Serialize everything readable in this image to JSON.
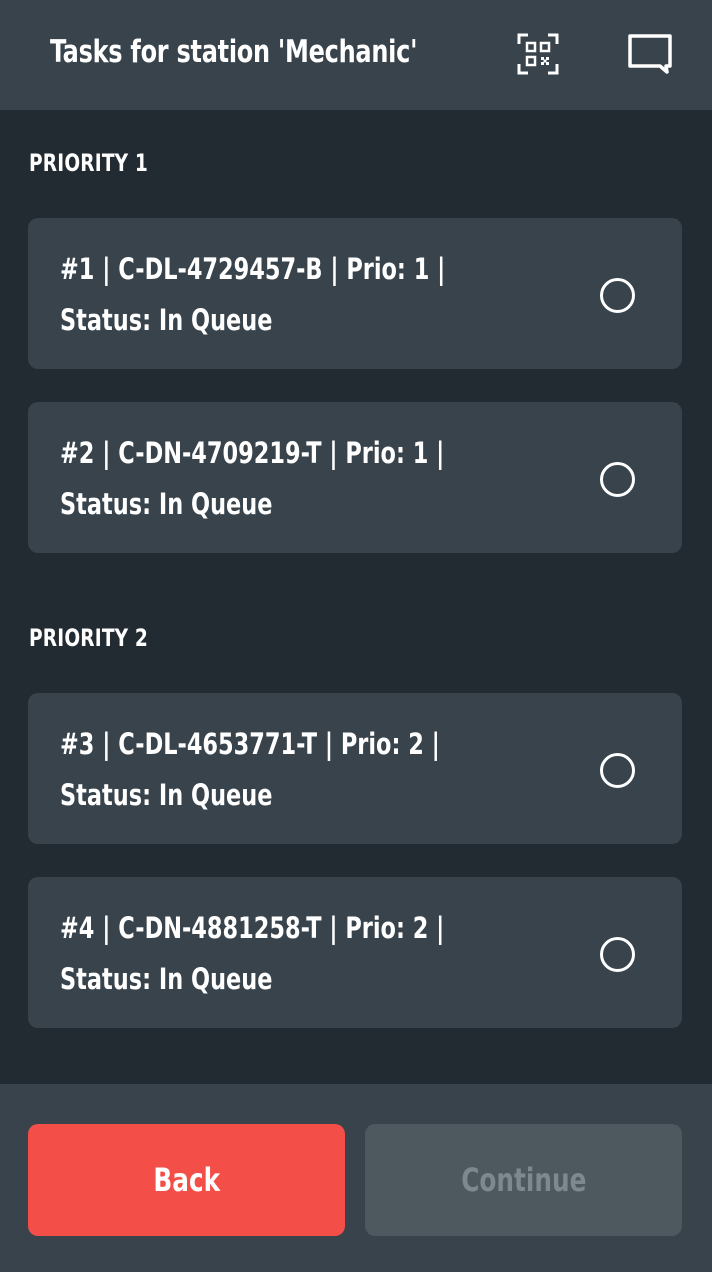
{
  "header": {
    "title": "Tasks for station 'Mechanic'",
    "qr_icon": "qr-code-icon",
    "chat_icon": "chat-bubble-icon"
  },
  "sections": [
    {
      "title": "PRIORITY 1",
      "tasks": [
        {
          "line1": "#1 | C-DL-4729457-B | Prio: 1 |",
          "line2": "Status: In Queue",
          "selected": false
        },
        {
          "line1": "#2 | C-DN-4709219-T | Prio: 1 |",
          "line2": "Status: In Queue",
          "selected": false
        }
      ]
    },
    {
      "title": "PRIORITY 2",
      "tasks": [
        {
          "line1": "#3 | C-DL-4653771-T | Prio: 2 |",
          "line2": "Status: In Queue",
          "selected": false
        },
        {
          "line1": "#4 | C-DN-4881258-T | Prio: 2 |",
          "line2": "Status: In Queue",
          "selected": false
        }
      ]
    }
  ],
  "footer": {
    "back_label": "Back",
    "continue_label": "Continue",
    "continue_enabled": false
  },
  "colors": {
    "background": "#232b32",
    "surface": "#38434b",
    "back_button": "#f34f48",
    "continue_disabled": "#4d585f",
    "continue_text_disabled": "#7e898f"
  }
}
